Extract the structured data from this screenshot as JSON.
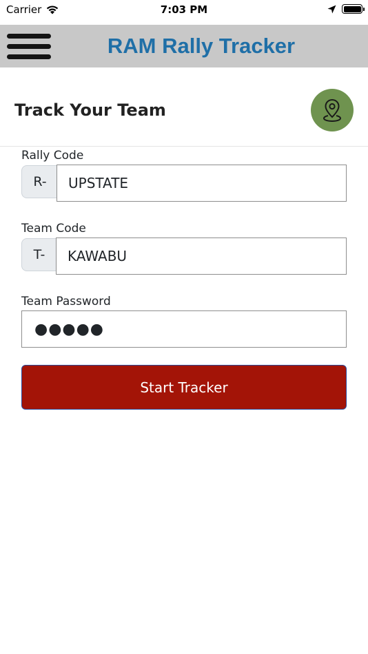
{
  "status_bar": {
    "carrier": "Carrier",
    "time": "7:03 PM",
    "wifi_icon": "wifi-icon",
    "location_icon": "location-arrow-icon",
    "battery_icon": "battery-icon"
  },
  "header": {
    "menu_icon": "hamburger-menu-icon",
    "title": "RAM Rally Tracker",
    "background_color": "#c8c8c8",
    "title_color": "#1f6fa7"
  },
  "section": {
    "title": "Track Your Team",
    "map_icon": "map-pin-icon",
    "map_button_color": "#6f934f"
  },
  "form": {
    "rally_code": {
      "label": "Rally Code",
      "prefix": "R-",
      "value": "UPSTATE"
    },
    "team_code": {
      "label": "Team Code",
      "prefix": "T-",
      "value": "KAWABU"
    },
    "team_password": {
      "label": "Team Password",
      "value": "●●●●●"
    },
    "submit_label": "Start Tracker",
    "submit_color": "#a31407"
  }
}
